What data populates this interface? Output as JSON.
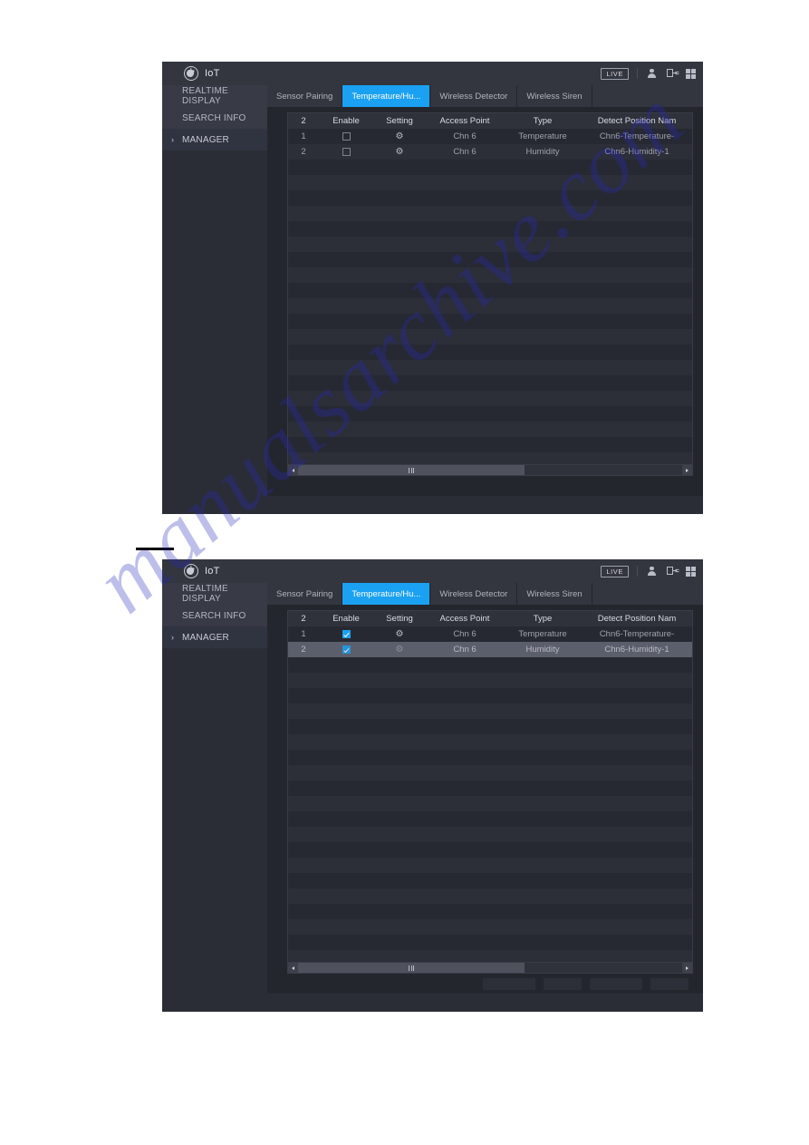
{
  "watermark": {
    "text": "manualsarchive.com",
    "color": "#2828be"
  },
  "window": {
    "title": "IoT",
    "logo_icon": "iot-globe-icon",
    "titlebar": {
      "live_label": "LIVE",
      "user_icon": "user-icon",
      "logout_icon": "logout-icon",
      "grid_icon": "grid-layout-icon"
    }
  },
  "sidebar": {
    "items": [
      {
        "label": "REALTIME DISPLAY",
        "selected": false
      },
      {
        "label": "SEARCH INFO",
        "selected": false
      },
      {
        "label": "MANAGER",
        "selected": true,
        "caret": "›"
      }
    ]
  },
  "tabs": [
    {
      "label": "Sensor Pairing",
      "active": false
    },
    {
      "label": "Temperature/Hu...",
      "active": true
    },
    {
      "label": "Wireless Detector",
      "active": false
    },
    {
      "label": "Wireless Siren",
      "active": false
    }
  ],
  "table": {
    "headers": {
      "count": "2",
      "enable": "Enable",
      "setting": "Setting",
      "access_point": "Access Point",
      "type": "Type",
      "detect_position": "Detect Position Nam"
    },
    "setting_icon": "gear-icon",
    "rows_unchecked": [
      {
        "index": "1",
        "enabled": false,
        "access_point": "Chn 6",
        "type": "Temperature",
        "detect_position": "Chn6-Temperature-",
        "selected": false
      },
      {
        "index": "2",
        "enabled": false,
        "access_point": "Chn 6",
        "type": "Humidity",
        "detect_position": "Chn6-Humidity-1",
        "selected": false
      }
    ],
    "rows_checked": [
      {
        "index": "1",
        "enabled": true,
        "access_point": "Chn 6",
        "type": "Temperature",
        "detect_position": "Chn6-Temperature-",
        "selected": false
      },
      {
        "index": "2",
        "enabled": true,
        "access_point": "Chn 6",
        "type": "Humidity",
        "detect_position": "Chn6-Humidity-1",
        "selected": true
      }
    ]
  },
  "scrollbar": {
    "left_arrow_icon": "arrow-left-icon",
    "right_arrow_icon": "arrow-right-icon",
    "thumb_position_percent": 0
  },
  "colors": {
    "accent_blue": "#1ba1f2",
    "window_bg": "#2b2d36",
    "content_bg": "#24262e",
    "row_selected": "#5b5e6b"
  }
}
